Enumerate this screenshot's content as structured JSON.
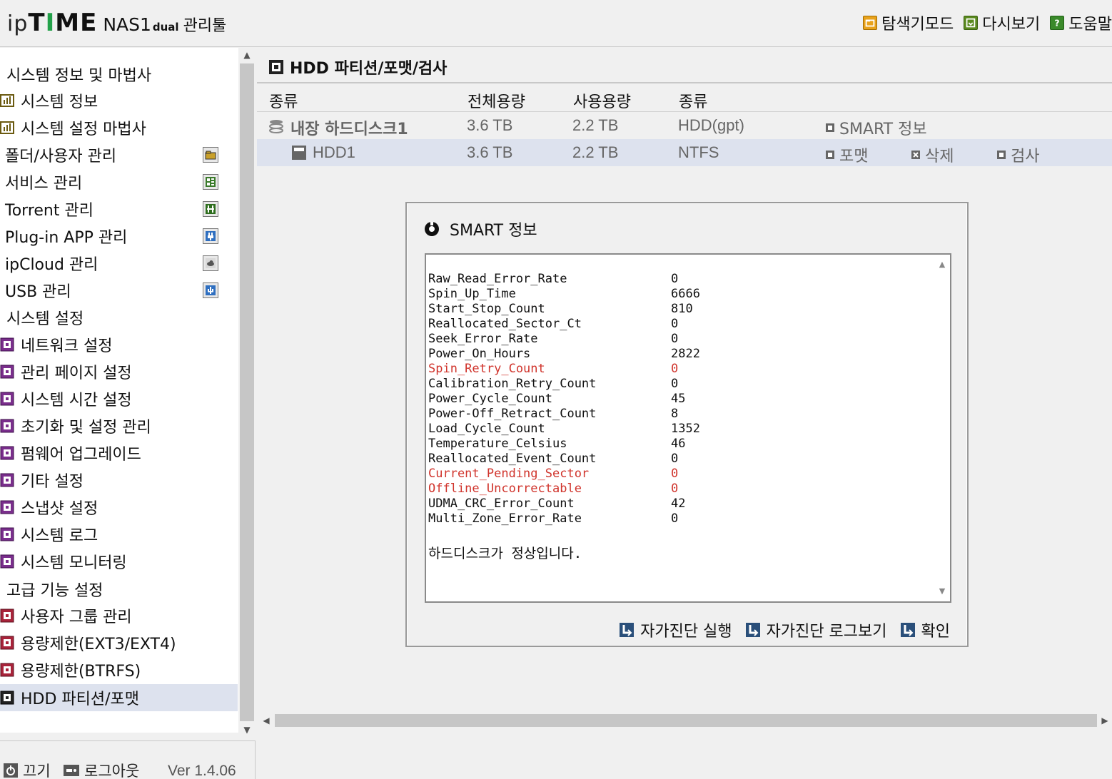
{
  "header": {
    "logo_ip": "ip",
    "logo_time_1": "T",
    "logo_time_2": "I",
    "logo_time_3": "ME",
    "logo_model": "NAS1",
    "logo_dual": "dual",
    "logo_tool": "관리툴",
    "nav": {
      "explore": "탐색기모드",
      "refresh": "다시보기",
      "help": "도움말"
    }
  },
  "sidebar": {
    "sections": {
      "system_info": "시스템 정보 및 마법사",
      "system_settings": "시스템 설정",
      "advanced": "고급 기능 설정"
    },
    "items": {
      "system_info": "시스템 정보",
      "setup_wizard": "시스템 설정 마법사",
      "folder_user": "폴더/사용자 관리",
      "service": "서비스 관리",
      "torrent": "Torrent 관리",
      "plugin": "Plug-in APP 관리",
      "ipcloud": "ipCloud 관리",
      "usb": "USB 관리",
      "network": "네트워크 설정",
      "admin_page": "관리 페이지 설정",
      "system_time": "시스템 시간 설정",
      "reset": "초기화 및 설정 관리",
      "firmware": "펌웨어 업그레이드",
      "etc": "기타 설정",
      "snapshot": "스냅샷 설정",
      "syslog": "시스템 로그",
      "monitoring": "시스템 모니터링",
      "user_group": "사용자 그룹 관리",
      "quota_ext": "용량제한(EXT3/EXT4)",
      "quota_btrfs": "용량제한(BTRFS)",
      "hdd_partition": "HDD 파티션/포맷"
    },
    "footer": {
      "power": "끄기",
      "logout": "로그아웃",
      "version": "Ver 1.4.06"
    }
  },
  "main": {
    "title": "HDD 파티션/포맷/검사",
    "columns": [
      "종류",
      "전체용량",
      "사용용량",
      "종류"
    ],
    "disk": {
      "name": "내장 하드디스크1",
      "total": "3.6 TB",
      "used": "2.2 TB",
      "type": "HDD(gpt)",
      "smart": "SMART 정보"
    },
    "partition": {
      "name": "HDD1",
      "total": "3.6 TB",
      "used": "2.2 TB",
      "type": "NTFS",
      "format": "포맷",
      "delete": "삭제",
      "check": "검사"
    }
  },
  "dialog": {
    "title": "SMART 정보",
    "attributes": [
      {
        "name": "Raw_Read_Error_Rate",
        "value": "0",
        "warn": false
      },
      {
        "name": "Spin_Up_Time",
        "value": "6666",
        "warn": false
      },
      {
        "name": "Start_Stop_Count",
        "value": "810",
        "warn": false
      },
      {
        "name": "Reallocated_Sector_Ct",
        "value": "0",
        "warn": false
      },
      {
        "name": "Seek_Error_Rate",
        "value": "0",
        "warn": false
      },
      {
        "name": "Power_On_Hours",
        "value": "2822",
        "warn": false
      },
      {
        "name": "Spin_Retry_Count",
        "value": "0",
        "warn": true
      },
      {
        "name": "Calibration_Retry_Count",
        "value": "0",
        "warn": false
      },
      {
        "name": "Power_Cycle_Count",
        "value": "45",
        "warn": false
      },
      {
        "name": "Power-Off_Retract_Count",
        "value": "8",
        "warn": false
      },
      {
        "name": "Load_Cycle_Count",
        "value": "1352",
        "warn": false
      },
      {
        "name": "Temperature_Celsius",
        "value": "46",
        "warn": false
      },
      {
        "name": "Reallocated_Event_Count",
        "value": "0",
        "warn": false
      },
      {
        "name": "Current_Pending_Sector",
        "value": "0",
        "warn": true
      },
      {
        "name": "Offline_Uncorrectable",
        "value": "0",
        "warn": true
      },
      {
        "name": "UDMA_CRC_Error_Count",
        "value": "42",
        "warn": false
      },
      {
        "name": "Multi_Zone_Error_Rate",
        "value": "0",
        "warn": false
      }
    ],
    "status": "하드디스크가 정상입니다.",
    "buttons": {
      "selftest": "자가진단 실행",
      "selftest_log": "자가진단 로그보기",
      "ok": "확인"
    }
  },
  "colors": {
    "warn": "#d0342c",
    "accent_green": "#23a14a",
    "active_row": "#dde2ee"
  }
}
